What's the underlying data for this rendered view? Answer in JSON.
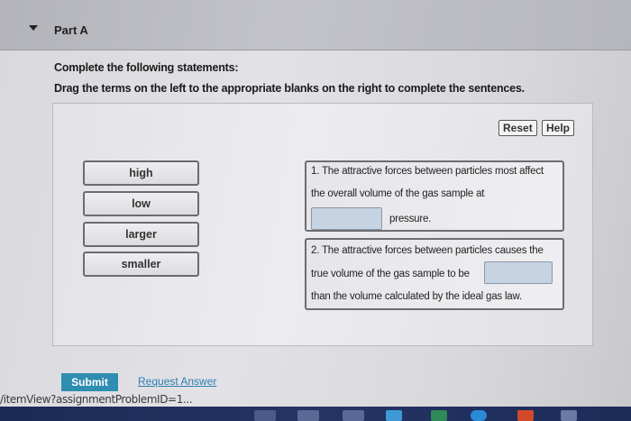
{
  "header": {
    "part_title": "Part A"
  },
  "instructions": {
    "line1": "Complete the following statements:",
    "line2": "Drag the terms on the left to the appropriate blanks on the right to complete the sentences."
  },
  "toolbar": {
    "reset_label": "Reset",
    "help_label": "Help"
  },
  "terms": [
    "high",
    "low",
    "larger",
    "smaller"
  ],
  "statement1": {
    "line1": "1. The attractive forces between particles most affect",
    "line2": "the overall volume of the gas sample at",
    "after_blank": "pressure."
  },
  "statement2": {
    "line1": "2. The attractive forces between particles causes the",
    "line2": "true volume of the gas sample to be",
    "line3": "than the volume calculated by the ideal gas law."
  },
  "footer": {
    "submit_label": "Submit",
    "request_answer_label": "Request Answer",
    "url_text": "/itemView?assignmentProblemID=1..."
  },
  "colors": {
    "accent": "#2f8db2",
    "blank_fill": "#c6d3e2"
  }
}
